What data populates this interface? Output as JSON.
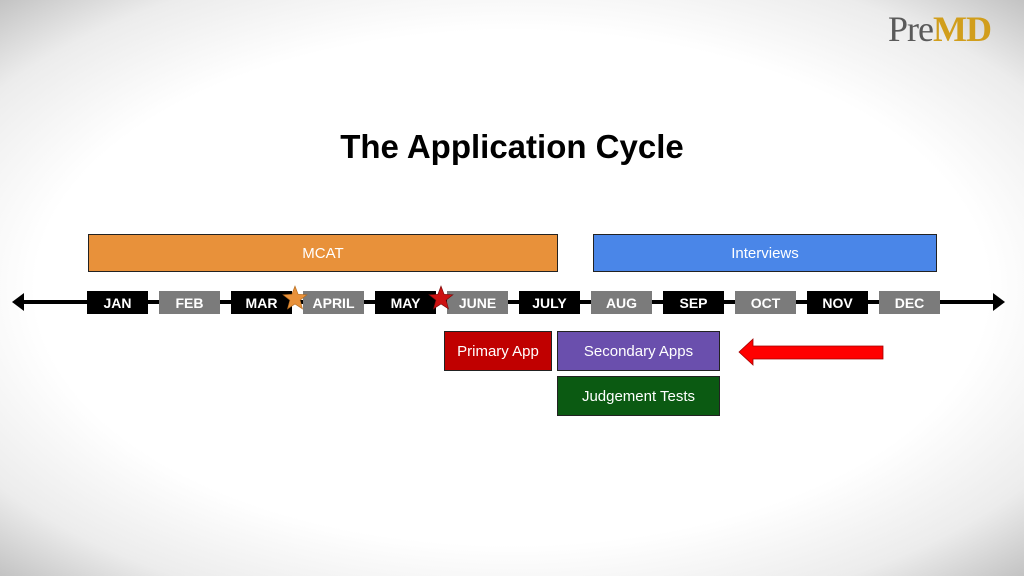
{
  "logo": {
    "pre": "Pre",
    "md": "MD"
  },
  "title": "The Application Cycle",
  "top_bars": [
    {
      "label": "MCAT",
      "color": "#e8913a",
      "span": "JAN-JULY"
    },
    {
      "label": "Interviews",
      "color": "#4a86e8",
      "span": "AUG-DEC"
    }
  ],
  "months": [
    "JAN",
    "FEB",
    "MAR",
    "APRIL",
    "MAY",
    "JUNE",
    "JULY",
    "AUG",
    "SEP",
    "OCT",
    "NOV",
    "DEC"
  ],
  "markers": [
    {
      "name": "orange-star",
      "color": "#e8913a",
      "between": "MAR-APRIL"
    },
    {
      "name": "red-star",
      "color": "#cc1111",
      "between": "MAY-JUNE"
    }
  ],
  "boxes": [
    {
      "label": "Primary App",
      "color": "#c00000"
    },
    {
      "label": "Secondary Apps",
      "color": "#6a4fad"
    },
    {
      "label": "Judgement Tests",
      "color": "#0b5a12"
    }
  ],
  "pointer_arrow": {
    "color": "#ff0000",
    "points_to": "Secondary Apps"
  }
}
